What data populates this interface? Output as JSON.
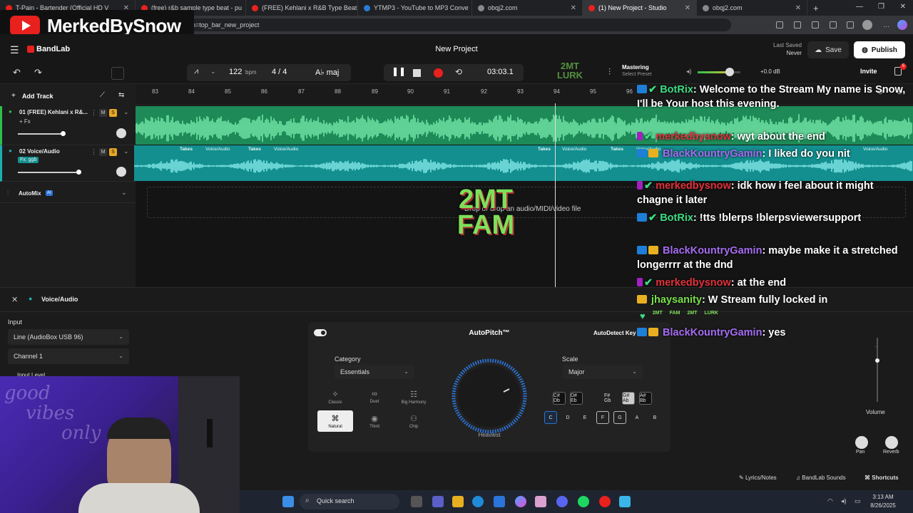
{
  "browser": {
    "tabs": [
      {
        "title": "T-Pain - Bartender (Official HD V",
        "color": "#e8211e"
      },
      {
        "title": "(free) r&b sample type beat - pu",
        "color": "#e8211e"
      },
      {
        "title": "(FREE) Kehlani x R&B Type Beat -",
        "color": "#e8211e"
      },
      {
        "title": "YTMP3 - YouTube to MP3 Conve",
        "color": "#2a7bd4"
      },
      {
        "title": "obqj2.com",
        "color": "#888888"
      },
      {
        "title": "(1) New Project - Studio",
        "color": "#e8211e"
      },
      {
        "title": "obqj2.com",
        "color": "#888888"
      }
    ],
    "url": "n=top_bar_new_project",
    "channel_logo": "MerkedBySnow"
  },
  "app": {
    "brand": "BandLab",
    "project_title": "New Project",
    "last_saved_label": "Last Saved",
    "last_saved_value": "Never",
    "save_label": "Save",
    "publish_label": "Publish",
    "invite_label": "Invite",
    "bpm_value": "122",
    "bpm_unit": "bpm",
    "time_sig": "4 / 4",
    "key": "A♭ maj",
    "time_display": "03:03.1",
    "mastering_label": "Mastering",
    "mastering_sub": "Select Preset",
    "volume_db": "+0.0 dB",
    "add_track_label": "Add Track",
    "ruler_ticks": [
      "83",
      "84",
      "85",
      "86",
      "87",
      "88",
      "89",
      "90",
      "91",
      "92",
      "93",
      "94",
      "95",
      "96"
    ]
  },
  "tracks": [
    {
      "name": "01  (FREE) Kehlani x R&...",
      "fx": "+ Fx",
      "m": "M",
      "s": "S"
    },
    {
      "name": "02  Voice/Audio",
      "fx": "Fx: ggb",
      "m": "M",
      "s": "S",
      "takes": "Takes",
      "clip": "Voice/Audio"
    }
  ],
  "automix": {
    "label": "AutoMix",
    "badge": "AI"
  },
  "dropzone_text": "Drop or drop an audio/MIDI/video file",
  "stream_overlay": {
    "line1": "2MT",
    "line2": "FAM",
    "corner1": "2MT",
    "corner2": "LURK"
  },
  "panel": {
    "title": "Voice/Audio",
    "input_label": "Input",
    "input_device": "Line (AudioBox USB 96)",
    "channel": "Channel 1",
    "input_level_label": "Input Level",
    "autopitch_label": "AutoPitch™",
    "autodetect_label": "AutoDetect Key",
    "category_label": "Category",
    "category_value": "Essentials",
    "modes": [
      "Classic",
      "Duet",
      "Big Harmony",
      "Natural",
      "Third",
      "Chip"
    ],
    "knob_label": "Heaviest",
    "scale_label": "Scale",
    "scale_value": "Major",
    "sharps": [
      "C#\nDb",
      "D#\nEb",
      "F#\nGb",
      "G#\nAb",
      "A#\nBb"
    ],
    "naturals": [
      "C",
      "D",
      "E",
      "F",
      "G",
      "A",
      "B"
    ],
    "volume_label": "Volume",
    "pan_label": "Pan",
    "reverb_label": "Reverb"
  },
  "bottom_links": {
    "lyrics": "Lyrics/Notes",
    "sounds": "BandLab Sounds",
    "shortcuts": "Shortcuts"
  },
  "chat": [
    {
      "user": "BotRix",
      "text": ": Welcome to the Stream My name is Snow, I'll be Your host this evening."
    },
    {
      "user": "merkedbysnow",
      "text": ": wyt about the end"
    },
    {
      "user": "BlackKountryGamin",
      "text": ": I liked do you nit"
    },
    {
      "user": "merkedbysnow",
      "text": ": idk how i feel about it might chagne it later"
    },
    {
      "user": "BotRix",
      "text": ": !tts !blerps !blerpsviewersupport"
    },
    {
      "user": "BlackKountryGamin",
      "text": ": maybe make it a stretched longerrrr at the dnd"
    },
    {
      "user": "merkedbysnow",
      "text": ": at the end"
    },
    {
      "user": "jhaysanity",
      "text": ": W Stream fully locked in"
    },
    {
      "user": "BlackKountryGamin",
      "text": ": yes"
    }
  ],
  "emote_row": [
    "2MT",
    "FAM",
    "2MT",
    "LURK"
  ],
  "webcam_text": [
    "good",
    "vibes",
    "only"
  ],
  "taskbar": {
    "search": "Quick search",
    "time": "3:13 AM",
    "date": "8/26/2025"
  }
}
